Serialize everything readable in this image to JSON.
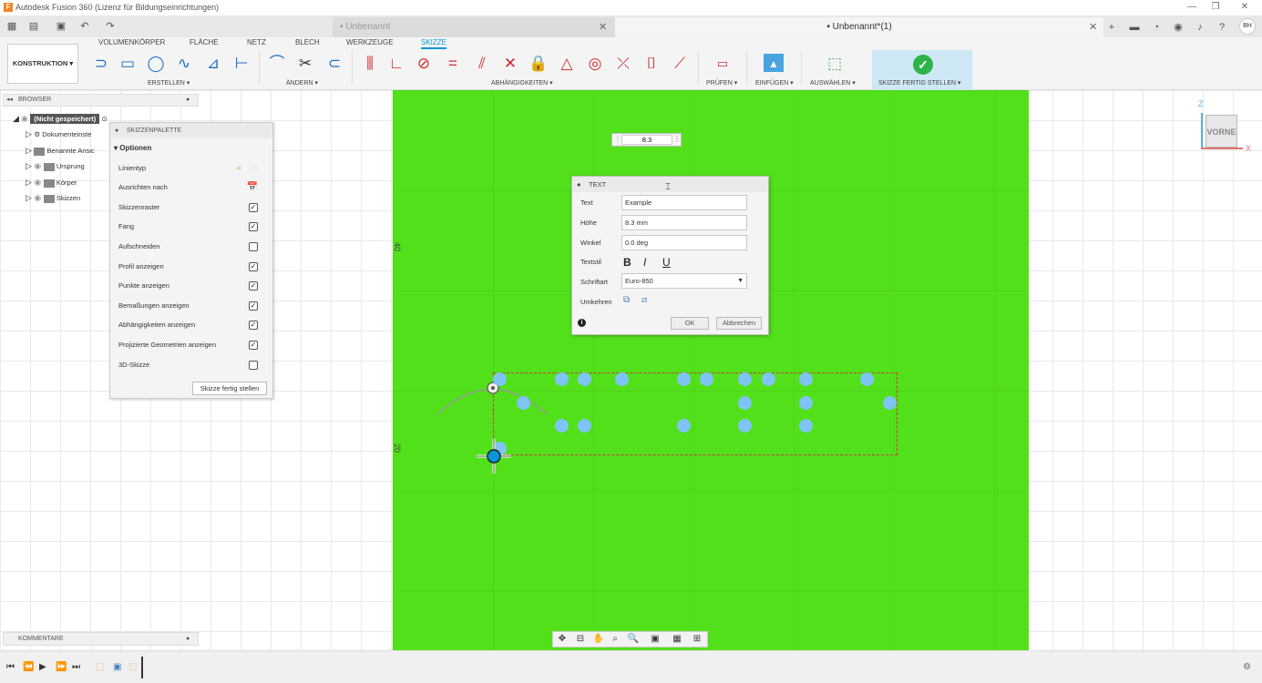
{
  "window": {
    "title": "Autodesk Fusion 360 (Lizenz für Bildungseinrichtungen)",
    "app_logo": "F",
    "minimize": "—",
    "restore": "❐",
    "close": "✕"
  },
  "tabs": [
    {
      "label": "Unbenannt",
      "close": "✕"
    },
    {
      "label": "Unbenannt*(1)",
      "close": "✕"
    }
  ],
  "user": {
    "initials": "BH"
  },
  "ribbon": {
    "tabs": [
      "VOLUMENKÖRPER",
      "FLÄCHE",
      "NETZ",
      "BLECH",
      "WERKZEUGE",
      "SKIZZE"
    ],
    "active_tab": "SKIZZE",
    "workspace": "KONSTRUKTION ▾",
    "groups": {
      "create": "ERSTELLEN ▾",
      "modify": "ÄNDERN ▾",
      "constraints": "ABHÄNGIGKEITEN ▾",
      "inspect": "PRÜFEN ▾",
      "insert": "EINFÜGEN ▾",
      "select": "AUSWÄHLEN ▾",
      "finish": "SKIZZE FERTIG STELLEN ▾"
    }
  },
  "browser": {
    "title": "BROWSER",
    "root": "(Nicht gespeichert)",
    "items": [
      "Dokumenteinste",
      "Benannte Ansic",
      "Ursprung",
      "Körper",
      "Skizzen"
    ]
  },
  "palette": {
    "title": "SKIZZENPALETTE",
    "section": "▾ Optionen",
    "options": [
      {
        "label": "Linientyp",
        "type": "icon"
      },
      {
        "label": "Ausrichten nach",
        "type": "icon"
      },
      {
        "label": "Skizzenraster",
        "checked": true
      },
      {
        "label": "Fang",
        "checked": true
      },
      {
        "label": "Aufschneiden",
        "checked": false
      },
      {
        "label": "Profil anzeigen",
        "checked": true
      },
      {
        "label": "Punkte anzeigen",
        "checked": true
      },
      {
        "label": "Bemaßungen anzeigen",
        "checked": true
      },
      {
        "label": "Abhängigkeiten anzeigen",
        "checked": true
      },
      {
        "label": "Projizierte Geometrien anzeigen",
        "checked": true
      },
      {
        "label": "3D-Skizze",
        "checked": false
      }
    ],
    "finish_button": "Skizze fertig stellen"
  },
  "dimension_input": {
    "value": "8.3"
  },
  "text_dialog": {
    "title": "TEXT",
    "text_label": "Text",
    "text_value": "Example",
    "height_label": "Höhe",
    "height_value": "8.3 mm",
    "angle_label": "Winkel",
    "angle_value": "0.0 deg",
    "style_label": "Textstil",
    "bold": "B",
    "italic": "I",
    "underline": "U",
    "font_label": "Schriftart",
    "font_value": "Euro-850",
    "flip_label": "Umkehren",
    "ok": "OK",
    "cancel": "Abbrechen"
  },
  "canvas": {
    "axis_labels": [
      "40",
      "20"
    ],
    "viewcube": "VORNE",
    "axis_z": "Z",
    "axis_x": "X"
  },
  "comments": {
    "title": "KOMMENTARE"
  },
  "colors": {
    "accent": "#0696d7",
    "sketch_plane": "#52e01a",
    "point": "#7ec4f4",
    "finish_check": "#2db34a"
  }
}
